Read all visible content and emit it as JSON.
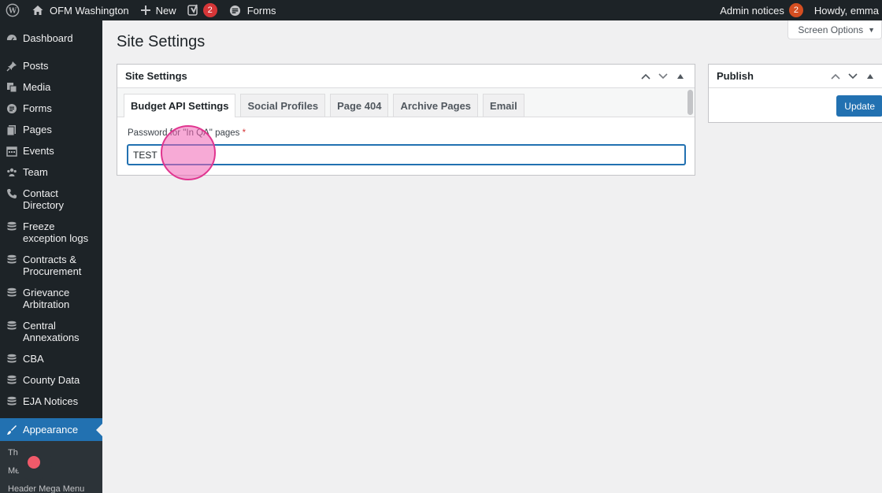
{
  "adminbar": {
    "site_name": "OFM Washington",
    "new_label": "New",
    "yoast_count": "2",
    "forms_label": "Forms",
    "admin_notices_label": "Admin notices",
    "admin_notices_count": "2",
    "howdy": "Howdy, emma"
  },
  "sidebar": {
    "items": [
      {
        "label": "Dashboard",
        "icon": "dashboard-icon"
      },
      {
        "label": "Posts",
        "icon": "pin-icon"
      },
      {
        "label": "Media",
        "icon": "media-icon"
      },
      {
        "label": "Forms",
        "icon": "forms-icon"
      },
      {
        "label": "Pages",
        "icon": "pages-icon"
      },
      {
        "label": "Events",
        "icon": "calendar-icon"
      },
      {
        "label": "Team",
        "icon": "groups-icon"
      },
      {
        "label": "Contact Directory",
        "icon": "phone-icon"
      },
      {
        "label": "Freeze exception logs",
        "icon": "database-icon"
      },
      {
        "label": "Contracts & Procurement",
        "icon": "database-icon"
      },
      {
        "label": "Grievance Arbitration",
        "icon": "database-icon"
      },
      {
        "label": "Central Annexations",
        "icon": "database-icon"
      },
      {
        "label": "CBA",
        "icon": "database-icon"
      },
      {
        "label": "County Data",
        "icon": "database-icon"
      },
      {
        "label": "EJA Notices",
        "icon": "database-icon"
      }
    ],
    "active_item": "Appearance",
    "submenu": [
      "Th",
      "Me",
      "Header Mega Menu"
    ]
  },
  "screen_options": "Screen Options",
  "page_title": "Site Settings",
  "settings_box": {
    "title": "Site Settings",
    "tabs": [
      "Budget API Settings",
      "Social Profiles",
      "Page 404",
      "Archive Pages",
      "Email"
    ],
    "active_tab": "Budget API Settings",
    "field_label": "Password for \"In QA\" pages",
    "required_mark": "*",
    "field_value": "TEST"
  },
  "publish_box": {
    "title": "Publish",
    "update_label": "Update"
  },
  "colors": {
    "adminbar_bg": "#1d2327",
    "accent": "#2271b1",
    "badge": "#d63638",
    "click_highlight": "#e0358f"
  }
}
